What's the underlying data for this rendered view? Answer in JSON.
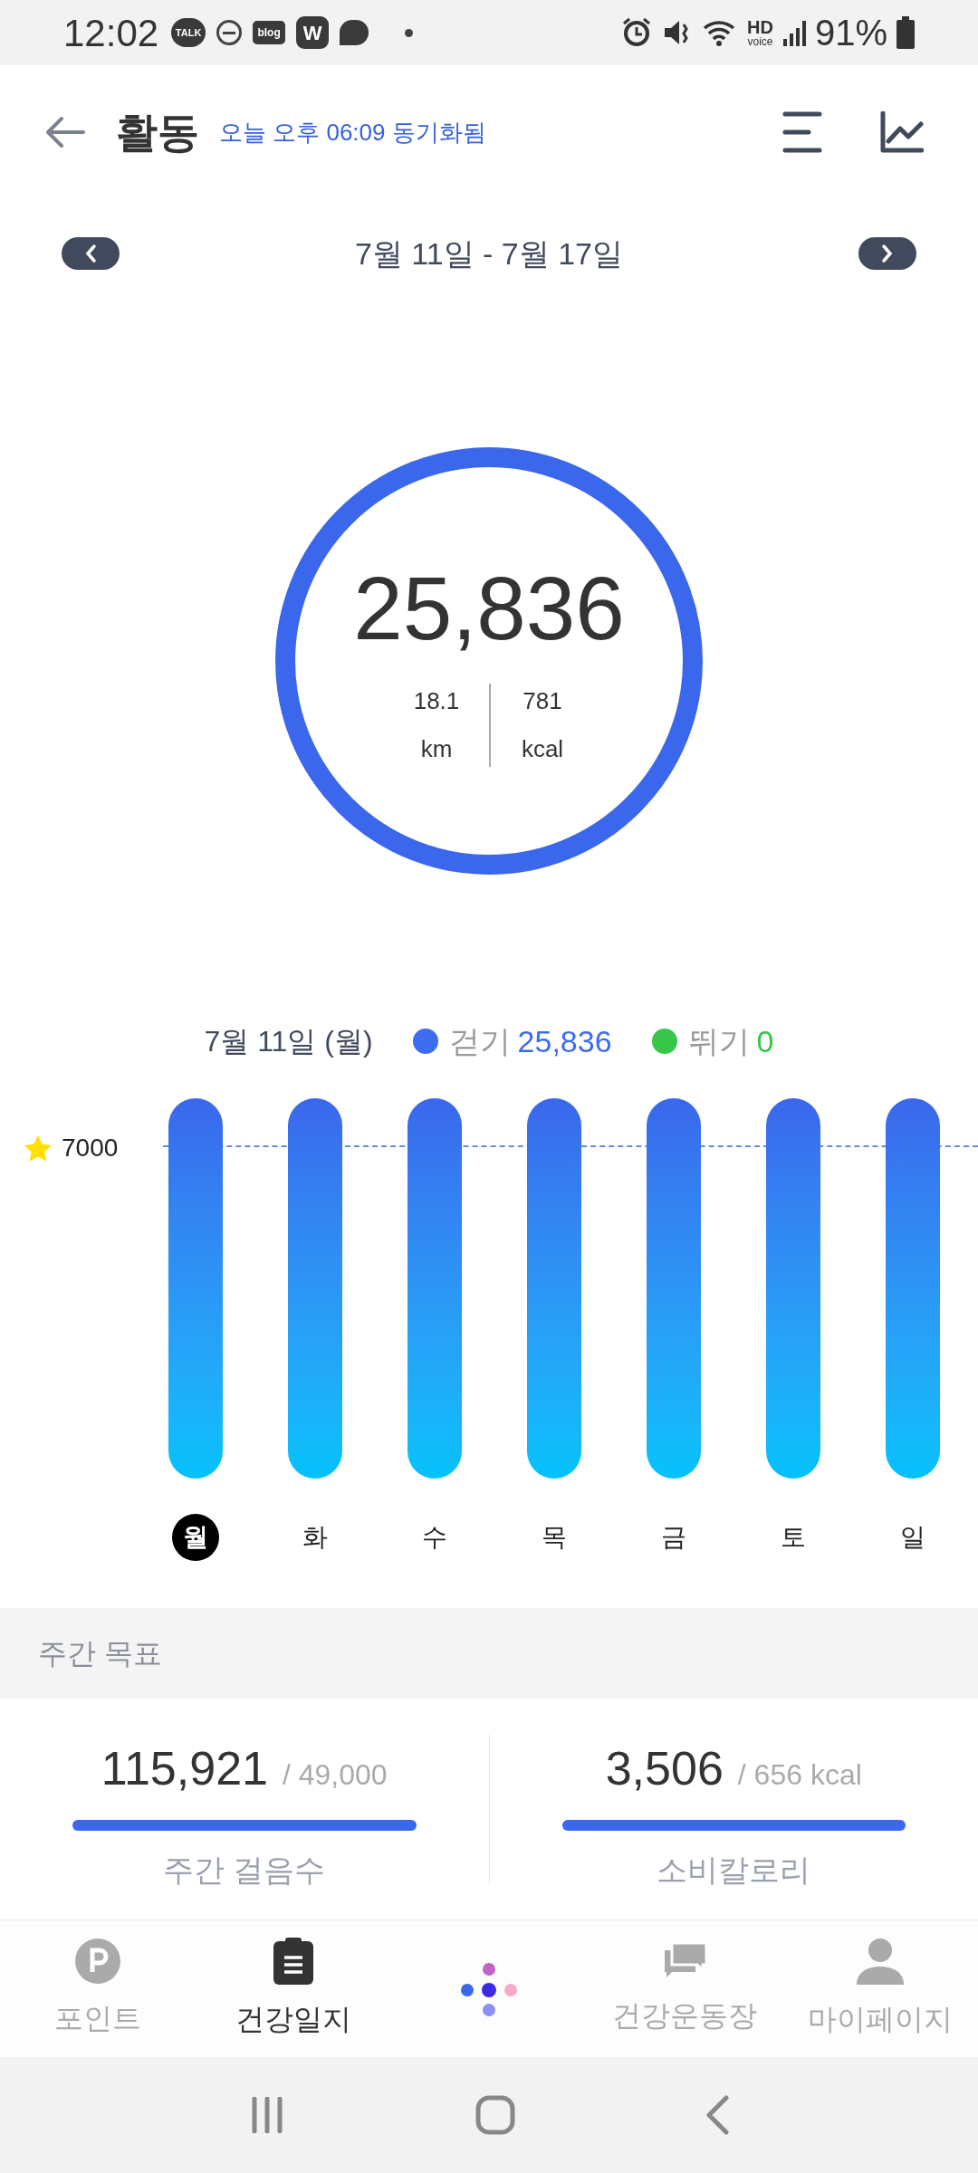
{
  "status_bar": {
    "time": "12:02",
    "notifications": [
      {
        "kind": "talk",
        "text": "TALK"
      },
      {
        "kind": "dnd"
      },
      {
        "kind": "blog",
        "text": "blog"
      },
      {
        "kind": "w",
        "text": "W"
      },
      {
        "kind": "bubble"
      },
      {
        "kind": "dot"
      }
    ],
    "hd": "HD",
    "voice": "voice",
    "battery": "91%"
  },
  "header": {
    "title": "활동",
    "sync_status": "오늘 오후 06:09 동기화됨"
  },
  "date_range": "7월 11일 - 7월 17일",
  "summary": {
    "steps": "25,836",
    "distance": "18.1",
    "distance_unit": "km",
    "calories": "781",
    "calories_unit": "kcal"
  },
  "daily": {
    "date": "7월 11일 (월)",
    "legend": [
      {
        "label": "걷기",
        "value": "25,836",
        "color": "#3d6cf0"
      },
      {
        "label": "뛰기",
        "value": "0",
        "color": "#37c648"
      }
    ],
    "goal": "7000",
    "days": [
      {
        "label": "월",
        "selected": true
      },
      {
        "label": "화",
        "selected": false
      },
      {
        "label": "수",
        "selected": false
      },
      {
        "label": "목",
        "selected": false
      },
      {
        "label": "금",
        "selected": false
      },
      {
        "label": "토",
        "selected": false
      },
      {
        "label": "일",
        "selected": false
      }
    ]
  },
  "weekly_goal": {
    "title": "주간 목표",
    "cards": [
      {
        "value": "115,921",
        "target": "/ 49,000",
        "level": 1,
        "label": "주간 걸음수"
      },
      {
        "value": "3,506",
        "target": "/ 656 kcal",
        "level": 1,
        "label": "소비칼로리"
      }
    ]
  },
  "tab_bar": [
    {
      "kind": "point",
      "label": "포인트",
      "selected": false
    },
    {
      "kind": "diary",
      "label": "건강일지",
      "selected": true
    },
    {
      "kind": "logo"
    },
    {
      "kind": "community",
      "label": "건강운동장",
      "selected": false
    },
    {
      "kind": "profile",
      "label": "마이페이지",
      "selected": false
    }
  ]
}
